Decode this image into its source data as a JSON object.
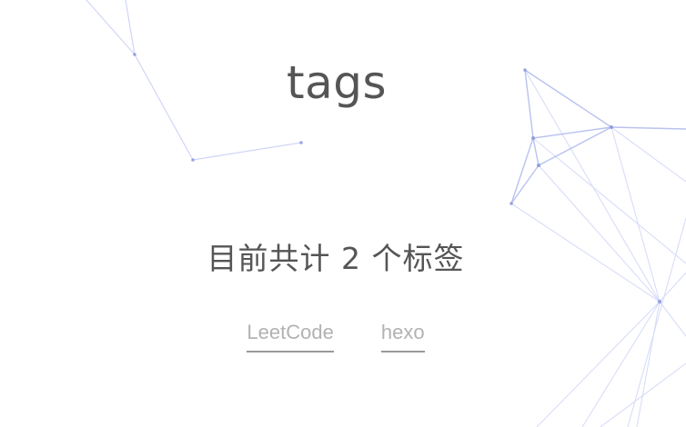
{
  "page": {
    "title": "tags",
    "tag_count_text": "目前共计 2 个标签"
  },
  "tags": [
    {
      "label": "LeetCode"
    },
    {
      "label": "hexo"
    }
  ],
  "colors": {
    "text": "#555555",
    "tag_text": "#b2b2b2",
    "tag_underline": "#999999",
    "network_line": "#aab4f0",
    "network_dot": "#7f8ed9"
  }
}
